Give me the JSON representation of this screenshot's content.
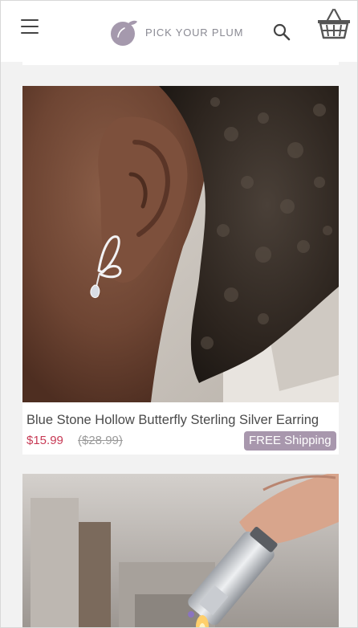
{
  "header": {
    "brand": "PICK YOUR PLUM",
    "menu_icon": "hamburger-menu-icon",
    "search_icon": "search-icon",
    "cart_icon": "shopping-basket-icon",
    "brand_color": "#a599ad"
  },
  "products": [
    {
      "title": "Blue Stone Hollow Butterfly Sterling Silver Earring",
      "price": "$15.99",
      "old_price": "($28.99)",
      "shipping_badge": "FREE Shipping"
    }
  ],
  "colors": {
    "price": "#c73a55",
    "badge": "#a897ad"
  }
}
